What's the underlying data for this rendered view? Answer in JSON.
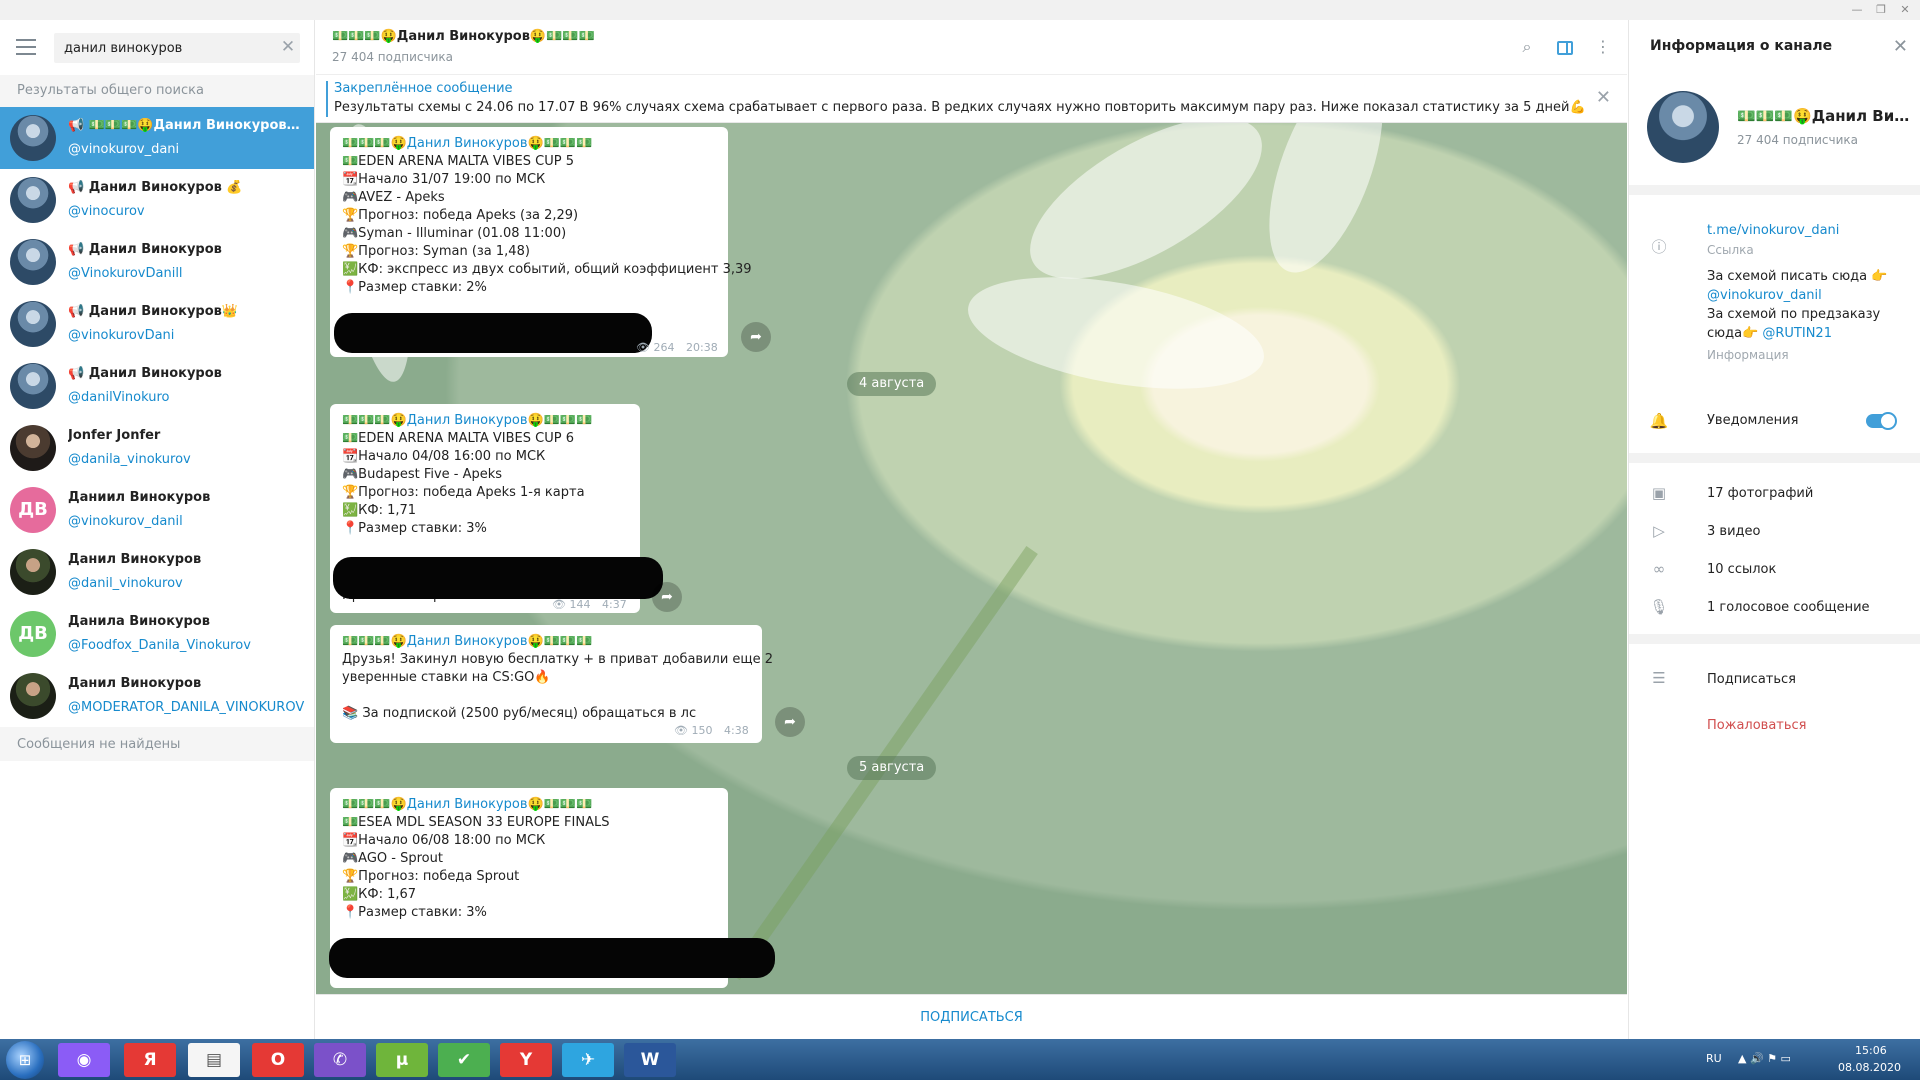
{
  "window": {
    "min": "—",
    "max": "❐",
    "close": "✕"
  },
  "left": {
    "search_value": "данил винокуров",
    "clear_icon": "✕",
    "section_global": "Результаты общего поиска",
    "no_messages": "Сообщения не найдены",
    "results": [
      {
        "name": "📢 💵💵💵🤑Данил Винокуров🤑💵💵💵",
        "username": "@vinokurov_dani"
      },
      {
        "name": "📢 Данил Винокуров 💰",
        "username": "@vinocurov"
      },
      {
        "name": "📢 Данил Винокуров",
        "username": "@VinokurovDanill"
      },
      {
        "name": "📢 Данил Винокуров👑",
        "username": "@vinokurovDani"
      },
      {
        "name": "📢 Данил Винокуров",
        "username": "@danilVinokuro"
      },
      {
        "name": "Jonfer Jonfer",
        "username": "@danila_vinokurov"
      },
      {
        "name": "Даниил Винокуров",
        "username": "@vinokurov_danil",
        "initials": "ДВ",
        "color": "#e66b9c"
      },
      {
        "name": "Данил Винокуров",
        "username": "@danil_vinokurov"
      },
      {
        "name": "Данила Винокуров",
        "username": "@Foodfox_Danila_Vinokurov",
        "initials": "ДВ",
        "color": "#6cc76a"
      },
      {
        "name": "Данил Винокуров",
        "username": "@MODERATOR_DANILA_VINOKUROV"
      }
    ]
  },
  "chat": {
    "title": "💵💵💵🤑Данил Винокуров🤑💵💵💵",
    "subscribers": "27 404 подписчика",
    "pinned_title": "Закреплённое сообщение",
    "pinned_text": "Результаты схемы с 24.06 по 17.07 В 96% случаях схема срабатывает с первого раза. В редких случаях нужно повторить максимум пару раз. Ниже показал статистику за 5 дней💪",
    "author": "💵💵💵🤑Данил Винокуров🤑💵💵💵",
    "messages": [
      {
        "lines": [
          "💵EDEN ARENA MALTA VIBES CUP 5",
          "📆Начало 31/07 19:00 по МСК",
          "🎮AVEZ - Apeks",
          "🏆Прогноз: победа Apeks (за 2,29)",
          "🎮Syman - Illuminar (01.08 11:00)",
          "🏆Прогноз: Syman (за 1,48)",
          "💹КФ: экспресс из двух событий, общий коэффициент 3,39",
          "📍Размер ставки: 2%"
        ],
        "views": "👁 264",
        "time": "20:38"
      },
      {
        "date": "4 августа",
        "lines": [
          "💵EDEN ARENA MALTA VIBES CUP 6",
          "📆Начало 04/08 16:00 по МСК",
          "🎮Budapest Five - Apeks",
          "🏆Прогноз: победа Apeks 1-я карта",
          "💹КФ: 1,71",
          "📍Размер ставки: 3%"
        ],
        "footer": "Приват 2500 р писать в лс",
        "views": "👁 144",
        "time": "4:37"
      },
      {
        "lines": [
          "Друзья! Закинул новую бесплатку + в приват добавили еще 2",
          "уверенные ставки на CS:GO🔥",
          "",
          "📚 За подпиской (2500 руб/месяц) обращаться в лс"
        ],
        "views": "👁 150",
        "time": "4:38"
      },
      {
        "date": "5 августа",
        "lines": [
          "💵ESEA MDL SEASON 33 EUROPE FINALS",
          "📆Начало 06/08 18:00 по МСК",
          "🎮AGO - Sprout",
          "🏆Прогноз: победа Sprout",
          "💹КФ: 1,67",
          "📍Размер ставки: 3%"
        ]
      }
    ],
    "subscribe": "ПОДПИСАТЬСЯ",
    "share_icon": "➦"
  },
  "right": {
    "title": "Информация о канале",
    "name": "💵💵💵🤑Данил Винокуров🤑💵💵💵",
    "subscribers": "27 404 подписчика",
    "link": "t.me/vinokurov_dani",
    "link_caption": "Ссылка",
    "desc_1": "За схемой писать сюда 👉",
    "desc_2": "@vinokurov_danil",
    "desc_3": "За схемой по предзаказу",
    "desc_4a": "сюда👉 ",
    "desc_4b": "@RUTIN21",
    "desc_caption": "Информация",
    "notifications": "Уведомления",
    "notifications_on": true,
    "photos": "17 фотографий",
    "videos": "3 видео",
    "links": "10 ссылок",
    "voice": "1 голосовое сообщение",
    "subscribe": "Подписаться",
    "report": "Пожаловаться"
  },
  "taskbar": {
    "lang": "RU",
    "time": "15:06",
    "date": "08.08.2020",
    "apps": [
      {
        "label": "◉",
        "color": "#8b5cf6"
      },
      {
        "label": "Я",
        "color": "#e53935"
      },
      {
        "label": "▤",
        "color": "#f5f5f5"
      },
      {
        "label": "O",
        "color": "#e53935"
      },
      {
        "label": "✆",
        "color": "#7b51c9"
      },
      {
        "label": "µ",
        "color": "#6fb53b"
      },
      {
        "label": "✔",
        "color": "#4caf50"
      },
      {
        "label": "Y",
        "color": "#e53935"
      },
      {
        "label": "✈",
        "color": "#2ea5e0"
      },
      {
        "label": "W",
        "color": "#2b579a"
      }
    ]
  }
}
